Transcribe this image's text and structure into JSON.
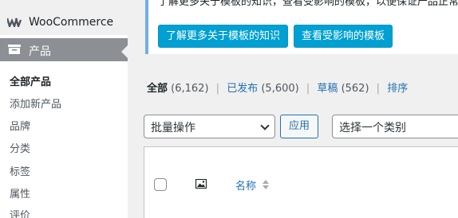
{
  "sidebar": {
    "woocommerce_label": "WooCommerce",
    "products_label": "产品",
    "submenu": [
      {
        "label": "全部产品",
        "active": true
      },
      {
        "label": "添加新产品",
        "active": false
      },
      {
        "label": "品牌",
        "active": false
      },
      {
        "label": "分类",
        "active": false
      },
      {
        "label": "标签",
        "active": false
      },
      {
        "label": "属性",
        "active": false
      },
      {
        "label": "评价",
        "active": false
      }
    ]
  },
  "notice": {
    "text": "了解更多关于模板的知识，查看受影响的模板，以便保证产品正常显示。",
    "learn_button": "了解更多关于模板的知识",
    "view_button": "查看受影响的模板"
  },
  "filters": {
    "all_label": "全部",
    "all_count": "(6,162)",
    "published_label": "已发布",
    "published_count": "(5,600)",
    "draft_label": "草稿",
    "draft_count": "(562)",
    "sort_label": "排序",
    "separator": "|"
  },
  "bulk": {
    "select_value": "批量操作",
    "apply_label": "应用",
    "category_value": "选择一个类别"
  },
  "table": {
    "name_header": "名称"
  },
  "colors": {
    "accent": "#2271b1",
    "button_blue": "#00a0d2",
    "sidebar_active": "#8c8f94"
  }
}
